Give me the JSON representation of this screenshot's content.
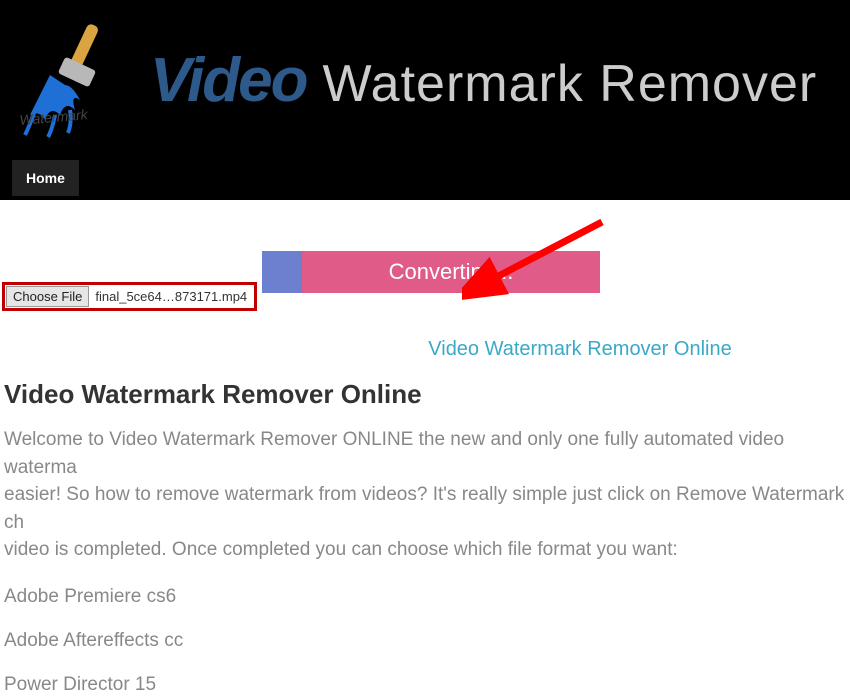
{
  "brand": {
    "video": "Video",
    "rest": "Watermark Remover"
  },
  "nav": {
    "home": "Home"
  },
  "fileChooser": {
    "button": "Choose File",
    "filename": "final_5ce64…873171.mp4"
  },
  "progress": {
    "label": "Converting..."
  },
  "link": {
    "text": "Video Watermark Remover Online"
  },
  "section": {
    "title": "Video Watermark Remover Online"
  },
  "paragraph": "Welcome to Video Watermark Remover ONLINE the new and only one fully automated video waterma\neasier! So how to remove watermark from videos? It's really simple just click on Remove Watermark ch\nvideo is completed. Once completed you can choose which file format you want:",
  "listItems": [
    "Adobe Premiere cs6",
    "Adobe Aftereffects cc",
    "Power Director 15"
  ]
}
